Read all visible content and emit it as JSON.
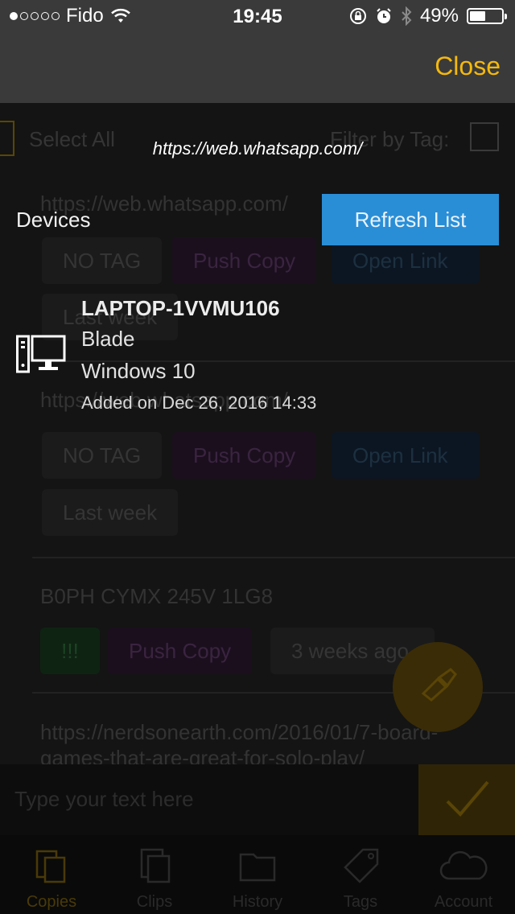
{
  "status_bar": {
    "carrier": "Fido",
    "signal_dots_filled": 1,
    "signal_dots_total": 5,
    "time": "19:45",
    "battery_percent": "49%",
    "battery_level": 0.49
  },
  "nav": {
    "close_label": "Close",
    "accent_color": "#f5b90b"
  },
  "background": {
    "select_all_label": "Select All",
    "filter_label": "Filter by Tag:",
    "clips": [
      {
        "title": "https://web.whatsapp.com/",
        "tag": "NO TAG",
        "push": "Push Copy",
        "open": "Open Link",
        "time": "Last week"
      },
      {
        "title": "https://web.whatsapp.com/",
        "tag": "NO TAG",
        "push": "Push Copy",
        "open": "Open Link",
        "time": "Last week"
      },
      {
        "title": "B0PH CYMX 245V 1LG8",
        "tag": "!!!",
        "push": "Push Copy",
        "time": "3 weeks ago"
      },
      {
        "title": "https://nerdsonearth.com/2016/01/7-board-games-that-are-great-for-solo-play/"
      }
    ],
    "input_placeholder": "Type your text here",
    "tabs": [
      {
        "label": "Copies",
        "icon": "copies-icon"
      },
      {
        "label": "Clips",
        "icon": "clips-icon"
      },
      {
        "label": "History",
        "icon": "folder-icon"
      },
      {
        "label": "Tags",
        "icon": "tag-icon"
      },
      {
        "label": "Account",
        "icon": "cloud-icon"
      }
    ]
  },
  "overlay": {
    "url": "https://web.whatsapp.com/",
    "devices_title": "Devices",
    "refresh_label": "Refresh List",
    "refresh_color": "#2a8ed6",
    "device": {
      "name": "LAPTOP-1VVMU106",
      "model": "Blade",
      "os": "Windows 10",
      "added": "Added on Dec 26, 2016 14:33",
      "icon": "computer-icon"
    }
  }
}
